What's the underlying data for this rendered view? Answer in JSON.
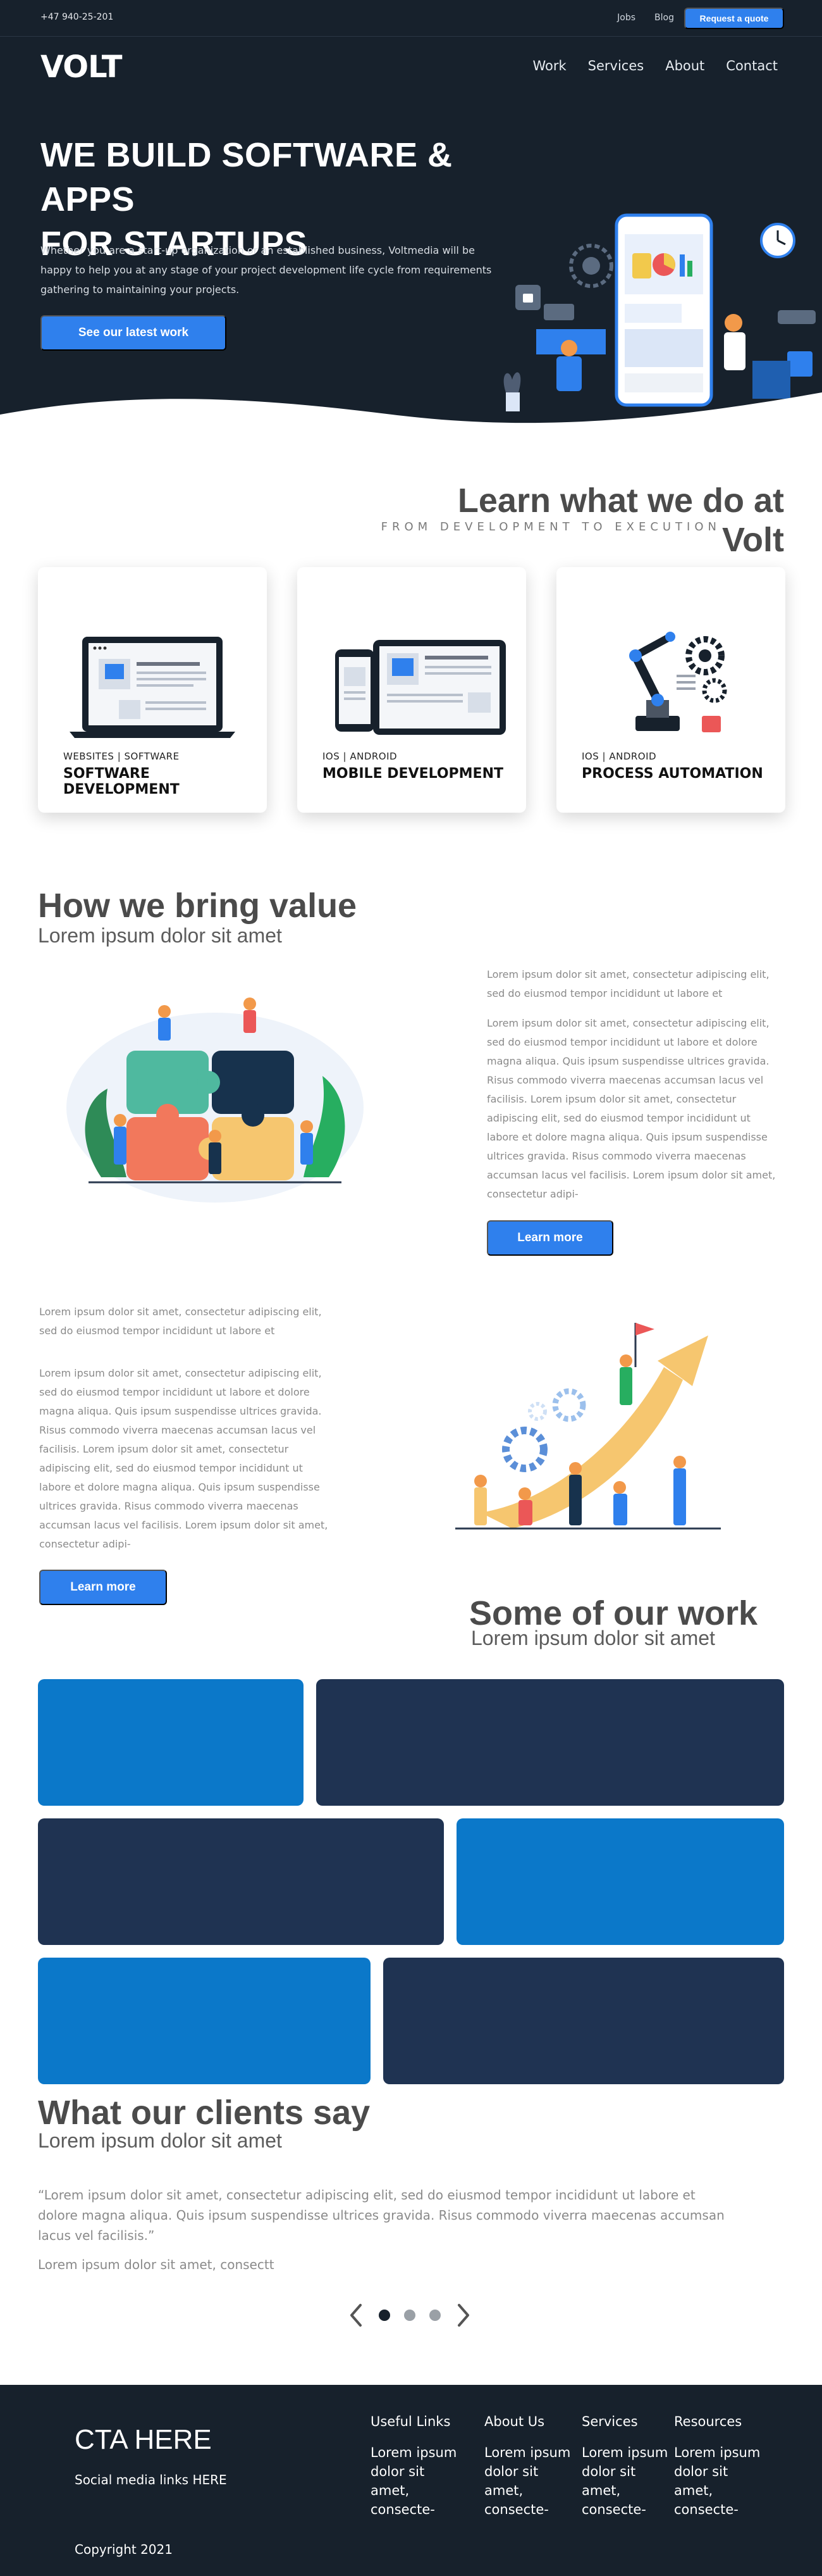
{
  "topbar": {
    "phone": "+47 940-25-201",
    "links": [
      "Jobs",
      "Blog"
    ],
    "quote_button": "Request a quote"
  },
  "brand": {
    "logo": "VOLT"
  },
  "nav": {
    "items": [
      "Work",
      "Services",
      "About",
      "Contact"
    ]
  },
  "hero": {
    "title_line1": "WE BUILD SOFTWARE & APPS",
    "title_line2": "FOR STARTUPS",
    "description": "Whether you are a start-up organization or an established business, Voltmedia will be happy to help you at any stage of your project development life cycle from requirements gathering to maintaining your projects.",
    "button": "See our latest work"
  },
  "services": {
    "title": "Learn what we do at Volt",
    "subtitle": "FROM DEVELOPMENT TO EXECUTION",
    "cards": [
      {
        "category": "WEBSITES  |  SOFTWARE",
        "name": "SOFTWARE DEVELOPMENT",
        "icon": "laptop-icon"
      },
      {
        "category": "IOS  |  ANDROID",
        "name": "MOBILE DEVELOPMENT",
        "icon": "mobile-tablet-icon"
      },
      {
        "category": "IOS  |  ANDROID",
        "name": "PROCESS AUTOMATION",
        "icon": "robot-arm-icon"
      }
    ]
  },
  "value": {
    "title": "How we bring value",
    "subtitle": "Lorem ipsum dolor sit amet",
    "block1": {
      "lead": "Lorem ipsum dolor sit amet, consectetur adipiscing elit, sed do eiusmod tempor incididunt ut labore et",
      "body": "Lorem ipsum dolor sit amet, consectetur adipiscing elit, sed do eiusmod tempor incididunt ut labore et dolore magna aliqua. Quis ipsum suspendisse ultrices gravida. Risus commodo viverra maecenas accumsan lacus vel facilisis. Lorem ipsum dolor sit amet, consectetur adipiscing elit, sed do eiusmod tempor incididunt ut labore et dolore magna aliqua. Quis ipsum suspendisse ultrices gravida. Risus commodo viverra maecenas accumsan lacus vel facilisis. Lorem ipsum dolor sit amet, consectetur adipi-",
      "button": "Learn more"
    },
    "block2": {
      "lead": "Lorem ipsum dolor sit amet, consectetur adipiscing elit, sed do eiusmod tempor incididunt ut labore et",
      "body": "Lorem ipsum dolor sit amet, consectetur adipiscing elit, sed do eiusmod tempor incididunt ut labore et dolore magna aliqua. Quis ipsum suspendisse ultrices gravida. Risus commodo viverra maecenas accumsan lacus vel facilisis. Lorem ipsum dolor sit amet, consectetur adipiscing elit, sed do eiusmod tempor incididunt ut labore et dolore magna aliqua. Quis ipsum suspendisse ultrices gravida. Risus commodo viverra maecenas accumsan lacus vel facilisis. Lorem ipsum dolor sit amet, consectetur adipi-",
      "button": "Learn more"
    }
  },
  "work": {
    "title": "Some of our work",
    "subtitle": "Lorem ipsum dolor sit amet",
    "colors": {
      "light": "#0b78c9",
      "dark": "#1f3352"
    }
  },
  "testimonials": {
    "title": "What our clients say",
    "subtitle": "Lorem ipsum dolor sit amet",
    "quote": "“Lorem ipsum dolor sit amet, consectetur adipiscing elit, sed do eiusmod tempor incididunt ut labore et dolore magna aliqua. Quis ipsum suspendisse ultrices gravida. Risus commodo viverra maecenas accumsan lacus vel facilisis.”",
    "author": "Lorem ipsum dolor sit amet, consectt",
    "carousel": {
      "current": 1,
      "total": 3
    }
  },
  "footer": {
    "cta": "CTA HERE",
    "social": "Social media links HERE",
    "copyright": "Copyright  2021",
    "columns": [
      {
        "heading": "Useful Links",
        "body": "Lorem ipsum dolor sit amet, consecte-"
      },
      {
        "heading": "About Us",
        "body": "Lorem ipsum dolor sit amet, consecte-"
      },
      {
        "heading": "Services",
        "body": "Lorem ipsum dolor sit amet, consecte-"
      },
      {
        "heading": "Resources",
        "body": "Lorem ipsum dolor sit amet, consecte-"
      }
    ]
  },
  "colors": {
    "navy": "#17212c",
    "accent": "#2f80ed"
  }
}
